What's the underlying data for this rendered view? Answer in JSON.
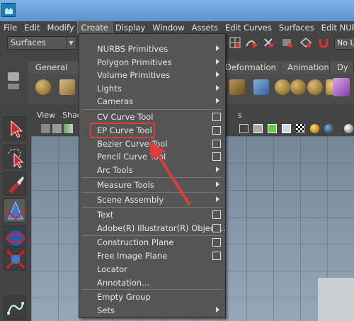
{
  "menubar": {
    "items": [
      "File",
      "Edit",
      "Modify",
      "Create",
      "Display",
      "Window",
      "Assets",
      "Edit Curves",
      "Surfaces",
      "Edit NURBS"
    ],
    "active_index": 3
  },
  "toolbar": {
    "mode_select": "Surfaces",
    "mode_arrow": "▼",
    "live_label": "No Live"
  },
  "shelf": {
    "tabs": [
      "General",
      "Deformation",
      "Animation",
      "Dy"
    ]
  },
  "viewport": {
    "menu": [
      "View",
      "Shad"
    ],
    "trailing": "s"
  },
  "create_menu": {
    "items": [
      {
        "label": "NURBS Primitives",
        "kind": "submenu"
      },
      {
        "label": "Polygon Primitives",
        "kind": "submenu"
      },
      {
        "label": "Volume Primitives",
        "kind": "submenu"
      },
      {
        "label": "Lights",
        "kind": "submenu"
      },
      {
        "label": "Cameras",
        "kind": "submenu"
      },
      {
        "label": "CV Curve Tool",
        "kind": "option"
      },
      {
        "label": "EP Curve Tool",
        "kind": "option"
      },
      {
        "label": "Bezier Curve Tool",
        "kind": "option"
      },
      {
        "label": "Pencil Curve Tool",
        "kind": "option"
      },
      {
        "label": "Arc Tools",
        "kind": "submenu"
      },
      {
        "label": "Measure Tools",
        "kind": "submenu"
      },
      {
        "label": "Scene Assembly",
        "kind": "submenu"
      },
      {
        "label": "Text",
        "kind": "option"
      },
      {
        "label": "Adobe(R) Illustrator(R) Object...",
        "kind": "option"
      },
      {
        "label": "Construction Plane",
        "kind": "option"
      },
      {
        "label": "Free Image Plane",
        "kind": "option"
      },
      {
        "label": "Locator",
        "kind": "plain"
      },
      {
        "label": "Annotation...",
        "kind": "plain"
      },
      {
        "label": "Empty Group",
        "kind": "plain"
      },
      {
        "label": "Sets",
        "kind": "submenu"
      }
    ],
    "highlighted": "EP Curve Tool"
  },
  "colors": {
    "highlight": "#e03c3c",
    "title_bar": "#6aa3dc"
  }
}
